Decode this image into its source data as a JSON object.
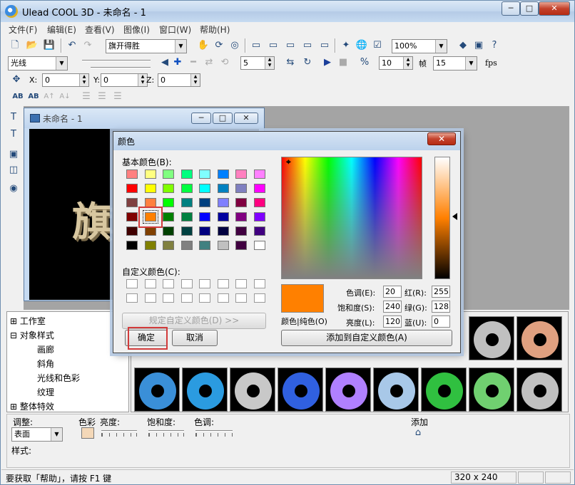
{
  "window": {
    "title": "Ulead COOL 3D - 未命名 - 1",
    "min": "─",
    "max": "□",
    "close": "✕"
  },
  "menu": [
    "文件(F)",
    "编辑(E)",
    "查看(V)",
    "图像(I)",
    "窗口(W)",
    "帮助(H)"
  ],
  "toolbar1": {
    "font_combo": "旗开得胜",
    "zoom_combo": "100%"
  },
  "toolbar2": {
    "object_combo": "光线",
    "frames_value": "5",
    "fps_spin": "10",
    "frame_label": "帧",
    "fps_combo": "15",
    "fps_label": "fps"
  },
  "toolbar3": {
    "x_label": "X:",
    "x_value": "0",
    "y_label": "Y:",
    "y_value": "0",
    "z_label": "Z:",
    "z_value": "0"
  },
  "toolbar4": [
    "AB",
    "AB",
    "A↑",
    "A↓"
  ],
  "child_window": {
    "title": "未命名 - 1",
    "canvas_text": "旗开"
  },
  "tree": [
    "工作室",
    "对象样式",
    "画廊",
    "斜角",
    "光线和色彩",
    "纹理",
    "整体特效"
  ],
  "properties": {
    "adjust_label": "调整:",
    "surface_combo": "表面",
    "color_label": "色彩",
    "brightness_label": "亮度:",
    "saturation_label": "饱和度:",
    "hue_label": "色调:",
    "add_label": "添加",
    "style_label": "样式:"
  },
  "status": {
    "text": "要获取「帮助」，请按 F1 键",
    "size": "320 x 240"
  },
  "dialog": {
    "title": "颜色",
    "basic_colors_label": "基本颜色(B):",
    "custom_colors_label": "自定义颜色(C):",
    "define_custom_button": "规定自定义颜色(D) >>",
    "ok_button": "确定",
    "cancel_button": "取消",
    "solid_label": "颜色|纯色(O)",
    "add_custom_button": "添加到自定义颜色(A)",
    "hue_label": "色调(E):",
    "hue": "20",
    "sat_label": "饱和度(S):",
    "sat": "240",
    "lum_label": "亮度(L):",
    "lum": "120",
    "red_label": "红(R):",
    "red": "255",
    "green_label": "绿(G):",
    "green": "128",
    "blue_label": "蓝(U):",
    "blue": "0",
    "basic_colors": [
      "#ff8080",
      "#ffff80",
      "#80ff80",
      "#00ff80",
      "#80ffff",
      "#0080ff",
      "#ff80c0",
      "#ff80ff",
      "#ff0000",
      "#ffff00",
      "#80ff00",
      "#00ff40",
      "#00ffff",
      "#0080c0",
      "#8080c0",
      "#ff00ff",
      "#804040",
      "#ff8040",
      "#00ff00",
      "#008080",
      "#004080",
      "#8080ff",
      "#800040",
      "#ff0080",
      "#800000",
      "#ff8000",
      "#008000",
      "#008040",
      "#0000ff",
      "#0000a0",
      "#800080",
      "#8000ff",
      "#400000",
      "#804000",
      "#004000",
      "#004040",
      "#000080",
      "#000040",
      "#400040",
      "#400080",
      "#000000",
      "#808000",
      "#808040",
      "#808080",
      "#408080",
      "#c0c0c0",
      "#400040",
      "#ffffff"
    ],
    "selected_index": 25
  },
  "gallery_colors": [
    "#3a8fd8",
    "#2b9be0",
    "#c8c8c8",
    "#3060e0",
    "#b080ff",
    "#a8c8e8",
    "#30c040",
    "#70d070",
    "#c0c0c0",
    "#e0a080"
  ]
}
